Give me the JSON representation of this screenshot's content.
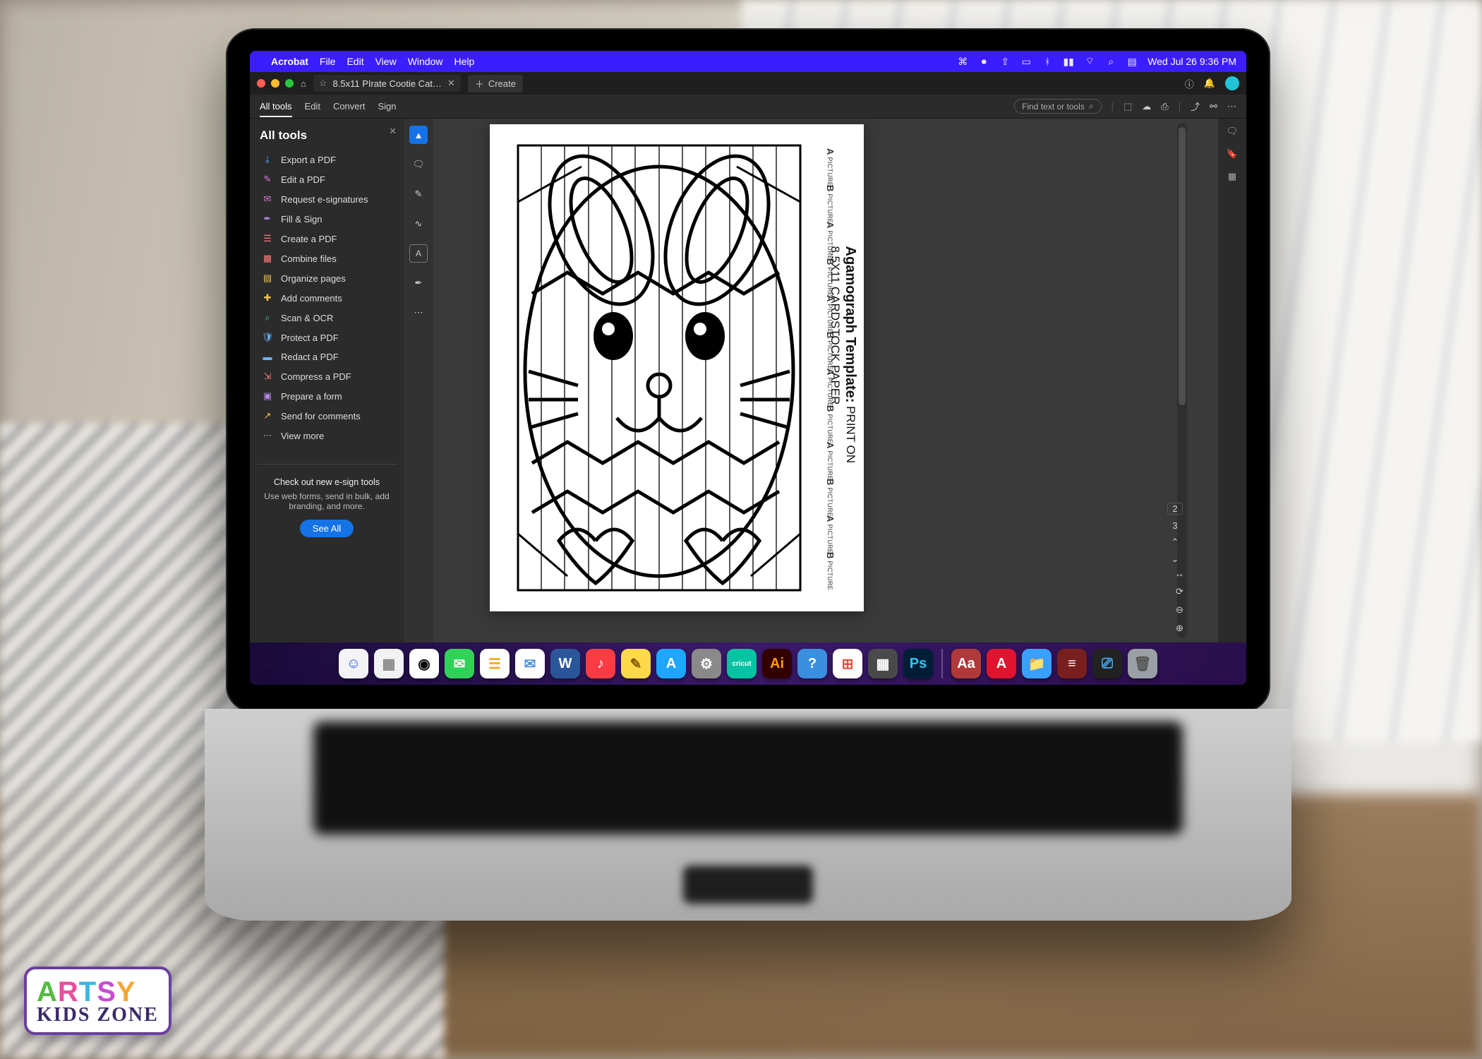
{
  "menubar": {
    "app": "Acrobat",
    "items": [
      "File",
      "Edit",
      "View",
      "Window",
      "Help"
    ],
    "clock": "Wed Jul 26  9:36 PM"
  },
  "titlebar": {
    "home_icon": "home-icon",
    "star_icon": "star-icon",
    "tab_label": "8.5x11 PIrate Cootie Cat…",
    "create_label": "Create",
    "bell_icon": "bell-icon"
  },
  "bar2": {
    "tabs": [
      "All tools",
      "Edit",
      "Convert",
      "Sign"
    ],
    "search_placeholder": "Find text or tools"
  },
  "sidebar": {
    "title": "All tools",
    "tools": [
      {
        "icon": "⤓",
        "color": "#4aa3ff",
        "label": "Export a PDF"
      },
      {
        "icon": "✎",
        "color": "#d877d8",
        "label": "Edit a PDF"
      },
      {
        "icon": "✉",
        "color": "#d877d8",
        "label": "Request e-signatures"
      },
      {
        "icon": "✒",
        "color": "#b488e8",
        "label": "Fill & Sign"
      },
      {
        "icon": "☰",
        "color": "#ff7a7a",
        "label": "Create a PDF"
      },
      {
        "icon": "▦",
        "color": "#ff7a7a",
        "label": "Combine files"
      },
      {
        "icon": "▤",
        "color": "#f0c34a",
        "label": "Organize pages"
      },
      {
        "icon": "✚",
        "color": "#f0c34a",
        "label": "Add comments"
      },
      {
        "icon": "⌕",
        "color": "#55c28a",
        "label": "Scan & OCR"
      },
      {
        "icon": "🛡",
        "color": "#6fb6ff",
        "label": "Protect a PDF"
      },
      {
        "icon": "▬",
        "color": "#6fb6ff",
        "label": "Redact a PDF"
      },
      {
        "icon": "⇲",
        "color": "#ff7a7a",
        "label": "Compress a PDF"
      },
      {
        "icon": "▣",
        "color": "#b488e8",
        "label": "Prepare a form"
      },
      {
        "icon": "↗",
        "color": "#f0c34a",
        "label": "Send for comments"
      },
      {
        "icon": "⋯",
        "color": "#bbbbbb",
        "label": "View more"
      }
    ],
    "promo_title": "Check out new e-sign tools",
    "promo_body": "Use web forms, send in bulk, add branding, and more.",
    "promo_cta": "See All"
  },
  "document": {
    "title_main": "Agamograph Template:",
    "title_sub": " PRINT ON 8.5X11 CARDSTOCK PAPER",
    "col_labels": [
      "A",
      "B",
      "A",
      "B",
      "A",
      "B",
      "A",
      "B",
      "A",
      "B",
      "A",
      "B"
    ],
    "col_sublabel": "PICTURE"
  },
  "pagenav": {
    "current": "2",
    "total": "3"
  },
  "dock": {
    "apps": [
      {
        "bg": "#f4f4f7",
        "fg": "#2255dd",
        "txt": "☺"
      },
      {
        "bg": "#f2f2f2",
        "fg": "#888",
        "txt": "▦"
      },
      {
        "bg": "#fff",
        "fg": "#000",
        "txt": "◉"
      },
      {
        "bg": "#32d158",
        "fg": "#fff",
        "txt": "✉"
      },
      {
        "bg": "#fff",
        "fg": "#f5a623",
        "txt": "☰"
      },
      {
        "bg": "#fff",
        "fg": "#4a90e2",
        "txt": "✉"
      },
      {
        "bg": "#2b579a",
        "fg": "#fff",
        "txt": "W"
      },
      {
        "bg": "#fc3c44",
        "fg": "#fff",
        "txt": "♪"
      },
      {
        "bg": "#ffd94a",
        "fg": "#8a5a00",
        "txt": "✎"
      },
      {
        "bg": "#1fa7ff",
        "fg": "#fff",
        "txt": "A"
      },
      {
        "bg": "#8a8a8a",
        "fg": "#fff",
        "txt": "⚙"
      },
      {
        "bg": "#06c3a3",
        "fg": "#fff",
        "txt": "cricut"
      },
      {
        "bg": "#330000",
        "fg": "#ff9a00",
        "txt": "Ai"
      },
      {
        "bg": "#3a8fe0",
        "fg": "#fff",
        "txt": "?"
      },
      {
        "bg": "#fff",
        "fg": "#e94e3a",
        "txt": "⊞"
      },
      {
        "bg": "#4a4a4a",
        "fg": "#fff",
        "txt": "▦"
      },
      {
        "bg": "#001e36",
        "fg": "#31c5f4",
        "txt": "Ps"
      },
      {
        "bg": "#b03a3a",
        "fg": "#fff",
        "txt": "Aa"
      },
      {
        "bg": "#e0142f",
        "fg": "#fff",
        "txt": "A"
      },
      {
        "bg": "#3aa0ff",
        "fg": "#fff",
        "txt": "📁"
      },
      {
        "bg": "#7a1f1f",
        "fg": "#fff",
        "txt": "≡"
      },
      {
        "bg": "#222",
        "fg": "#4ae",
        "txt": "⎚"
      },
      {
        "bg": "#9aa0a6",
        "fg": "#555",
        "txt": "🗑"
      }
    ]
  },
  "logo": {
    "l1": "ARTSY",
    "l2": "KIDS ZONE"
  }
}
